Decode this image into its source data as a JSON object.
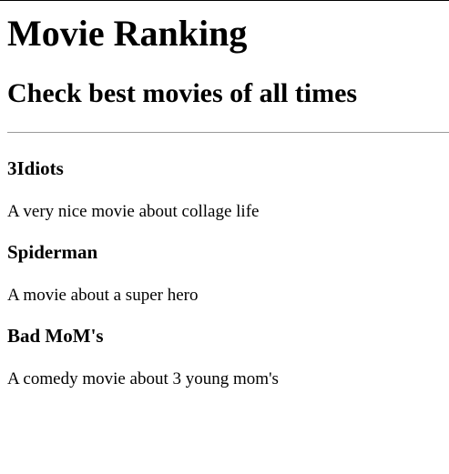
{
  "header": {
    "title": "Movie Ranking",
    "subtitle": "Check best movies of all times"
  },
  "movies": [
    {
      "title": "3Idiots",
      "description": "A very nice movie about collage life"
    },
    {
      "title": "Spiderman",
      "description": "A movie about a super hero"
    },
    {
      "title": "Bad MoM's",
      "description": "A comedy movie about 3 young mom's"
    }
  ]
}
